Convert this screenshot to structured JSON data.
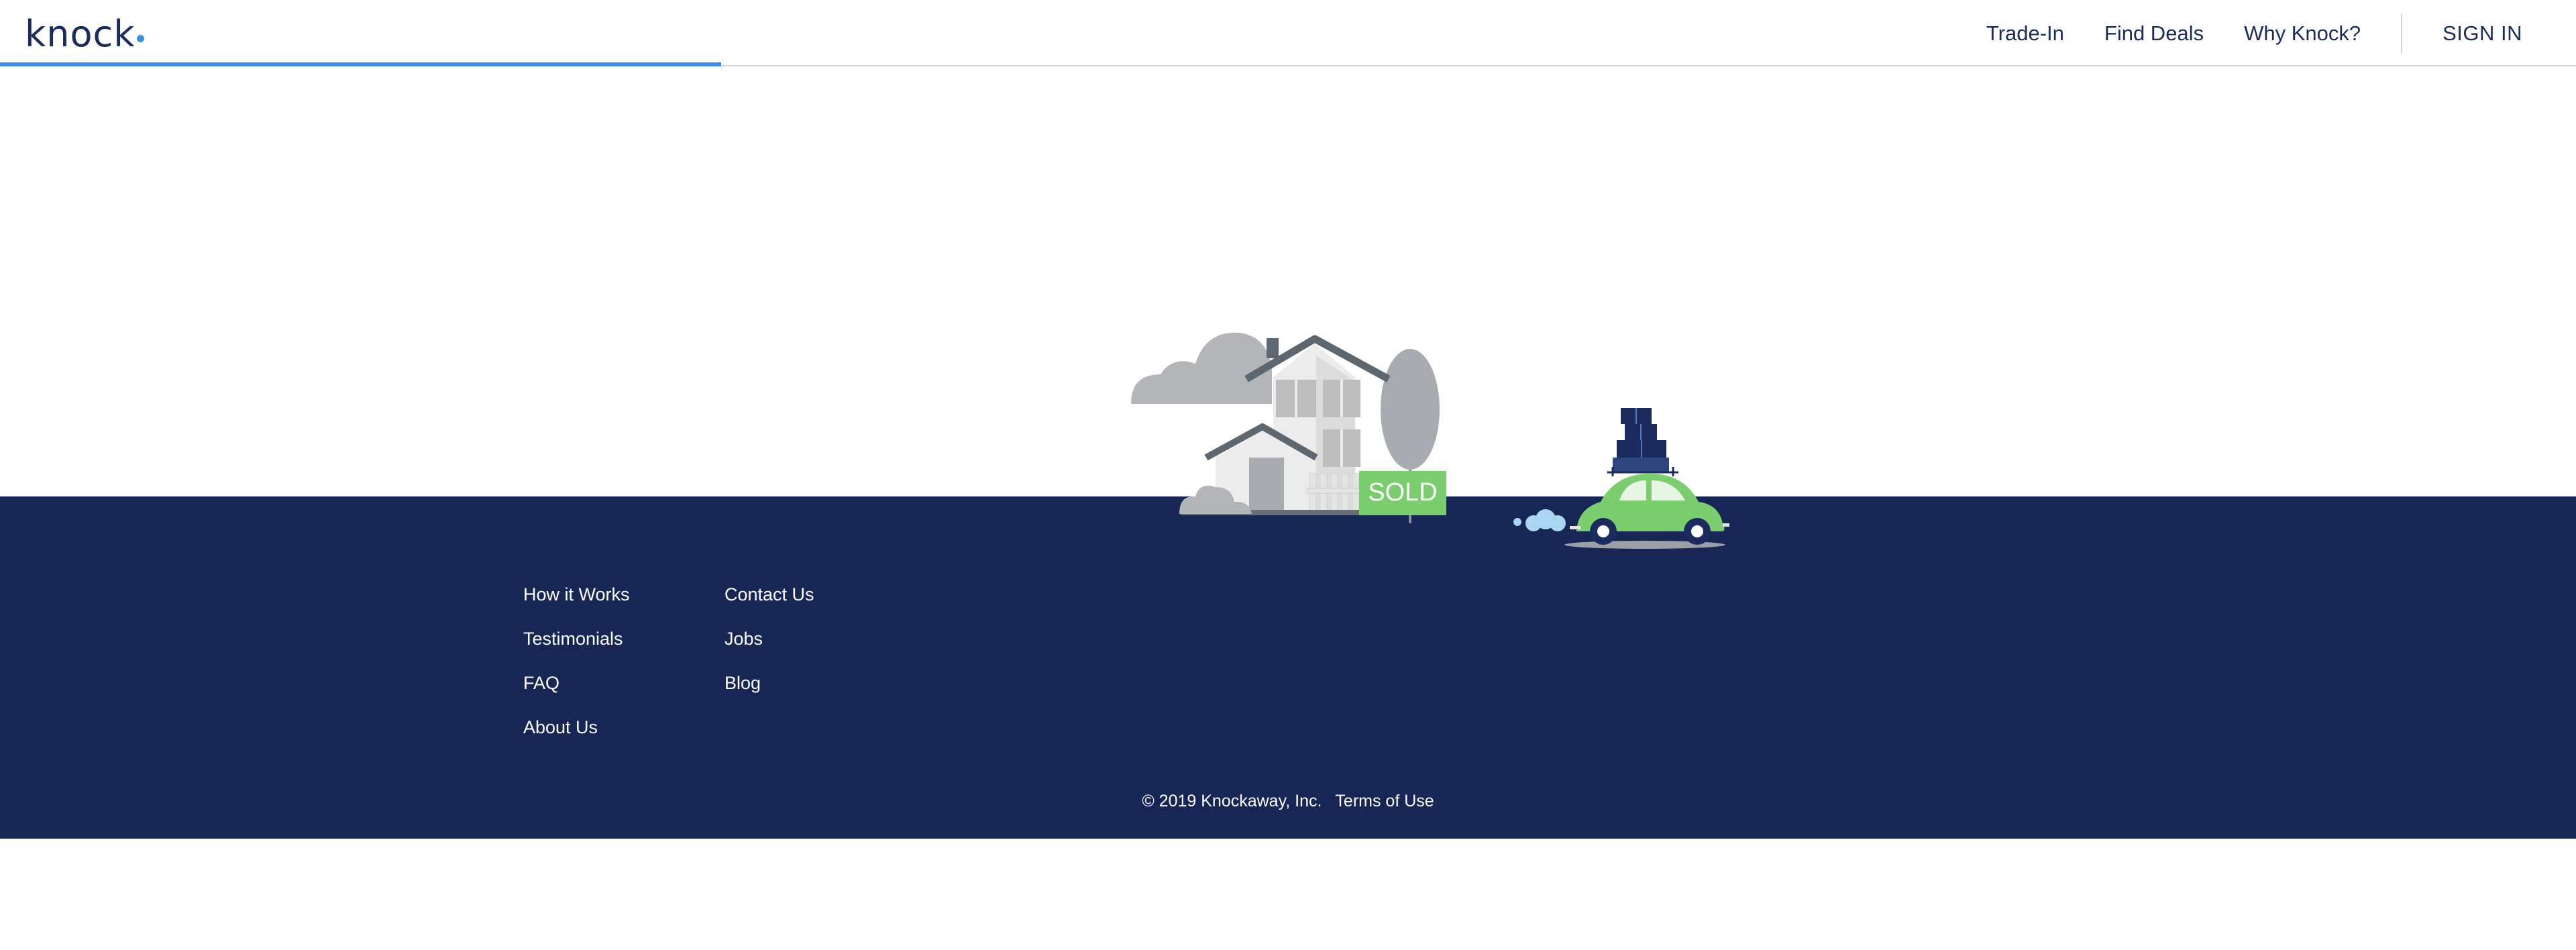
{
  "header": {
    "logo_text": "knock",
    "nav": {
      "trade_in": "Trade-In",
      "find_deals": "Find Deals",
      "why_knock": "Why Knock?",
      "sign_in": "SIGN IN"
    },
    "progress_fraction": 0.28
  },
  "illustration": {
    "sold_sign": "SOLD"
  },
  "footer": {
    "col1": [
      "How it Works",
      "Testimonials",
      "FAQ",
      "About Us"
    ],
    "col2": [
      "Contact Us",
      "Jobs",
      "Blog"
    ],
    "copyright": "© 2019 Knockaway, Inc.",
    "terms": "Terms of Use"
  },
  "colors": {
    "navy": "#182656",
    "accent_blue": "#3a8ee6",
    "green": "#7bce6e"
  }
}
